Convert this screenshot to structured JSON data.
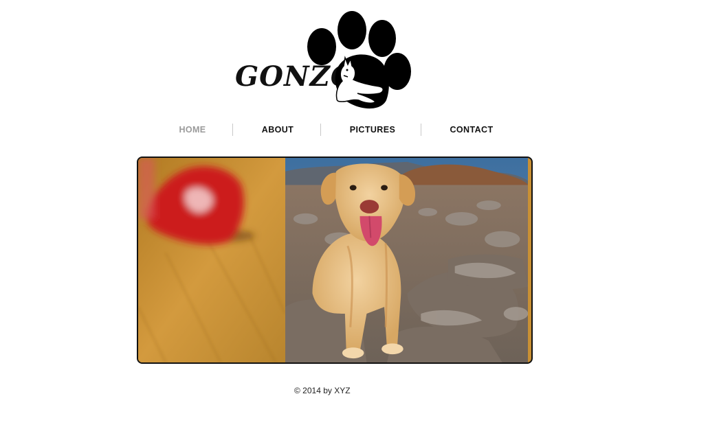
{
  "logo": {
    "text": "GONZO",
    "icon": "paw-print-dog-icon"
  },
  "nav": {
    "items": [
      {
        "label": "HOME",
        "active": true
      },
      {
        "label": "ABOUT",
        "active": false
      },
      {
        "label": "PICTURES",
        "active": false
      },
      {
        "label": "CONTACT",
        "active": false
      }
    ]
  },
  "slideshow": {
    "left_image": "blurred-red-toy-on-wooden-floor",
    "right_image": "yellow-labrador-sitting-on-rocks"
  },
  "footer": {
    "copyright": "© 2014 by XYZ"
  },
  "colors": {
    "text": "#111111",
    "nav_active": "#9a9a9a",
    "border": "#111111"
  }
}
